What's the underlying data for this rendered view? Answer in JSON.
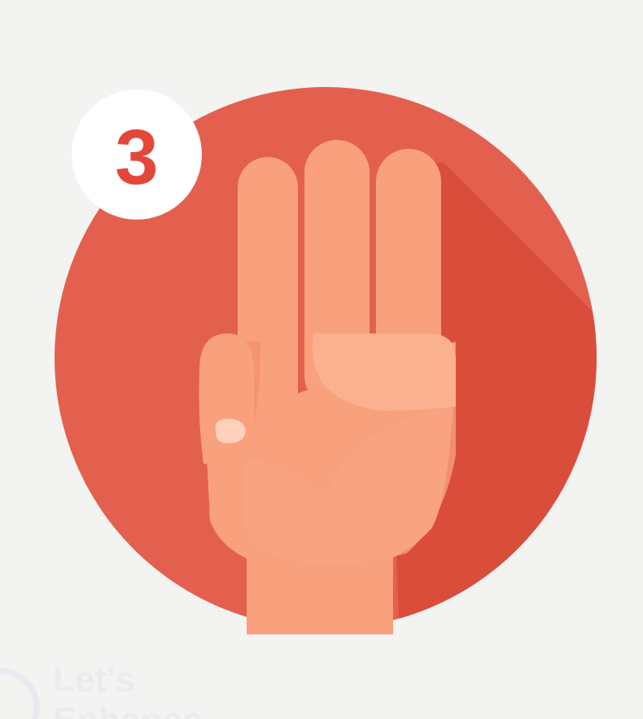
{
  "badge": {
    "number": "3"
  },
  "watermark": {
    "text_line1": "Let's",
    "text_line2": "Enhance"
  },
  "colors": {
    "background": "#f3f3f1",
    "circle": "#e4604e",
    "circle_shadow": "#d84b3a",
    "skin": "#f9a07d",
    "skin_shade": "#f28c68",
    "badge_fill": "#ffffff",
    "badge_text": "#e4473a"
  }
}
